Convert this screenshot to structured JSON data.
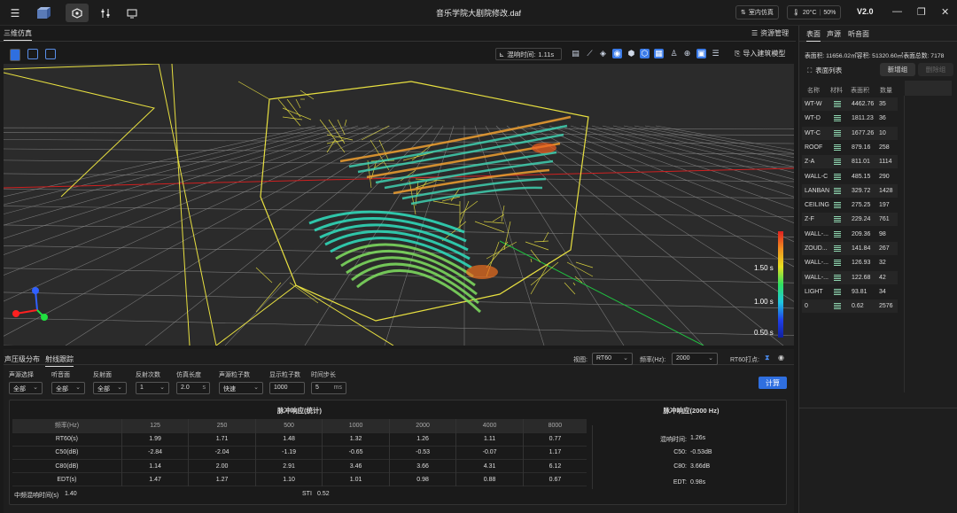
{
  "titlebar": {
    "title": "音乐学院大剧院修改.daf",
    "mode_label": "室内仿真",
    "temperature": "20°C",
    "humidity": "50%",
    "version": "V2.0"
  },
  "main_tabs": [
    "三维仿真"
  ],
  "resource_label": "资源管理",
  "toolbar": {
    "reverb_time_label": "混响时间:",
    "reverb_time_value": "1.11s",
    "import_label": "导入建筑模型"
  },
  "legend": {
    "ticks": [
      "1.50 s",
      "1.00 s",
      "0.50 s"
    ]
  },
  "right_panel": {
    "tabs": [
      "表面",
      "声源",
      "听音面"
    ],
    "stats": "表面积: 11656.02㎡容积: 51320.60㎥表面总数: 7178",
    "list_title": "表面列表",
    "add_label": "新增组",
    "delete_label": "删除组",
    "columns": [
      "名称",
      "材料",
      "表面积",
      "数量"
    ],
    "surfaces": [
      {
        "name": "WT-W",
        "area": "4462.76",
        "count": "35"
      },
      {
        "name": "WT-D",
        "area": "1811.23",
        "count": "36"
      },
      {
        "name": "WT-C",
        "area": "1677.26",
        "count": "10"
      },
      {
        "name": "ROOF",
        "area": "879.16",
        "count": "258"
      },
      {
        "name": "Z-A",
        "area": "811.01",
        "count": "1114"
      },
      {
        "name": "WALL-C",
        "area": "485.15",
        "count": "290"
      },
      {
        "name": "LANBAN",
        "area": "329.72",
        "count": "1428"
      },
      {
        "name": "CEILING",
        "area": "275.25",
        "count": "197"
      },
      {
        "name": "Z-F",
        "area": "229.24",
        "count": "761"
      },
      {
        "name": "WALL-...",
        "area": "209.36",
        "count": "98"
      },
      {
        "name": "ZOUD...",
        "area": "141.84",
        "count": "267"
      },
      {
        "name": "WALL-...",
        "area": "126.93",
        "count": "32"
      },
      {
        "name": "WALL-...",
        "area": "122.68",
        "count": "42"
      },
      {
        "name": "LIGHT",
        "area": "93.81",
        "count": "34"
      },
      {
        "name": "0",
        "area": "0.62",
        "count": "2576"
      }
    ]
  },
  "bottom": {
    "tabs": [
      "声压级分布",
      "射线跟踪"
    ],
    "view_label": "视图:",
    "view_value": "RT60",
    "freq_label": "频率(Hz):",
    "freq_value": "2000",
    "rt60_label": "RT60打点:",
    "fields": [
      {
        "label": "声源选择",
        "value": "全部"
      },
      {
        "label": "听音面",
        "value": "全部"
      },
      {
        "label": "反射面",
        "value": "全部"
      },
      {
        "label": "反射次数",
        "value": "1"
      },
      {
        "label": "仿真长度",
        "value": "2.0",
        "unit": "s"
      },
      {
        "label": "声源粒子数",
        "value": "快速"
      },
      {
        "label": "显示粒子数",
        "value": "1000"
      },
      {
        "label": "时间步长",
        "value": "5",
        "unit": "ms"
      }
    ],
    "calc_label": "计算",
    "table_title": "脉冲响应(统计)",
    "table_header": [
      "频率(Hz)",
      "125",
      "250",
      "500",
      "1000",
      "2000",
      "4000",
      "8000"
    ],
    "table_rows": [
      [
        "RT60(s)",
        "1.99",
        "1.71",
        "1.48",
        "1.32",
        "1.26",
        "1.11",
        "0.77"
      ],
      [
        "C50(dB)",
        "-2.84",
        "-2.04",
        "-1.19",
        "-0.65",
        "-0.53",
        "-0.07",
        "1.17"
      ],
      [
        "C80(dB)",
        "1.14",
        "2.00",
        "2.91",
        "3.46",
        "3.66",
        "4.31",
        "6.12"
      ],
      [
        "EDT(s)",
        "1.47",
        "1.27",
        "1.10",
        "1.01",
        "0.98",
        "0.88",
        "0.67"
      ]
    ],
    "mid_reverb_label": "中频混响时间(s)",
    "mid_reverb_value": "1.40",
    "sti_label": "STI",
    "sti_value": "0.52",
    "impulse_title": "脉冲响应(2000 Hz)",
    "impulse": [
      {
        "label": "混响时间:",
        "value": "1.26s"
      },
      {
        "label": "C50:",
        "value": "-0.53dB"
      },
      {
        "label": "C80:",
        "value": "3.66dB"
      },
      {
        "label": "EDT:",
        "value": "0.98s"
      }
    ]
  }
}
